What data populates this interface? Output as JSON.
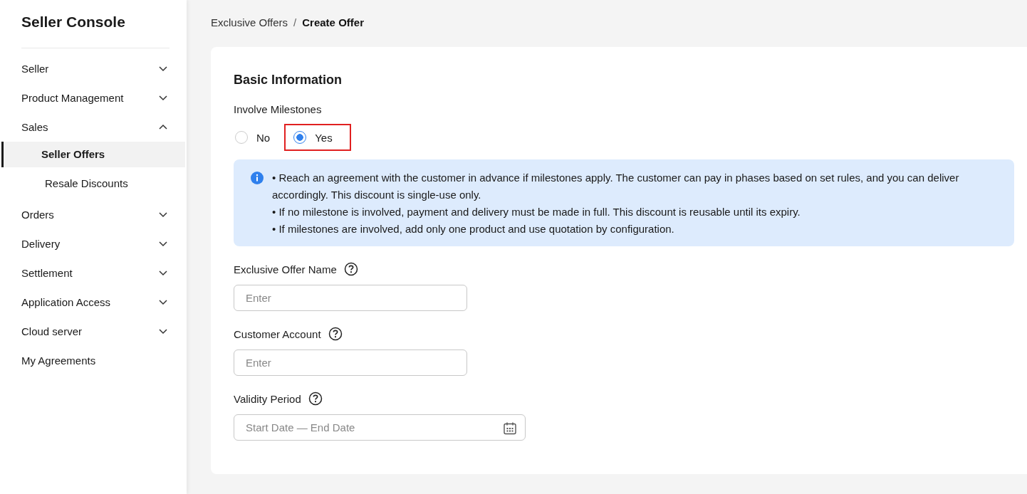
{
  "sidebar": {
    "title": "Seller Console",
    "items": [
      {
        "label": "Seller",
        "expanded": false
      },
      {
        "label": "Product Management",
        "expanded": false
      },
      {
        "label": "Sales",
        "expanded": true,
        "children": [
          {
            "label": "Seller Offers",
            "selected": true
          },
          {
            "label": "Resale Discounts",
            "selected": false
          }
        ]
      },
      {
        "label": "Orders",
        "expanded": false
      },
      {
        "label": "Delivery",
        "expanded": false
      },
      {
        "label": "Settlement",
        "expanded": false
      },
      {
        "label": "Application Access",
        "expanded": false
      },
      {
        "label": "Cloud server",
        "expanded": false
      },
      {
        "label": "My Agreements",
        "kind": "link"
      }
    ]
  },
  "breadcrumb": {
    "items": [
      "Exclusive Offers",
      "Create Offer"
    ],
    "separator": "/"
  },
  "form": {
    "section_title": "Basic Information",
    "milestones": {
      "label": "Involve Milestones",
      "options": [
        {
          "label": "No",
          "selected": false,
          "highlighted": false
        },
        {
          "label": "Yes",
          "selected": true,
          "highlighted": true
        }
      ]
    },
    "notice": [
      "• Reach an agreement with the customer in advance if milestones apply. The customer can pay in phases based on set rules, and you can deliver accordingly. This discount is single-use only.",
      "• If no milestone is involved, payment and delivery must be made in full. This discount is reusable until its expiry.",
      "• If milestones are involved, add only one product and use quotation by configuration."
    ],
    "fields": [
      {
        "label": "Exclusive Offer Name",
        "kind": "text",
        "placeholder": "Enter"
      },
      {
        "label": "Customer Account",
        "kind": "text",
        "placeholder": "Enter"
      },
      {
        "label": "Validity Period",
        "kind": "daterange",
        "placeholder": "Start Date — End Date"
      }
    ]
  }
}
